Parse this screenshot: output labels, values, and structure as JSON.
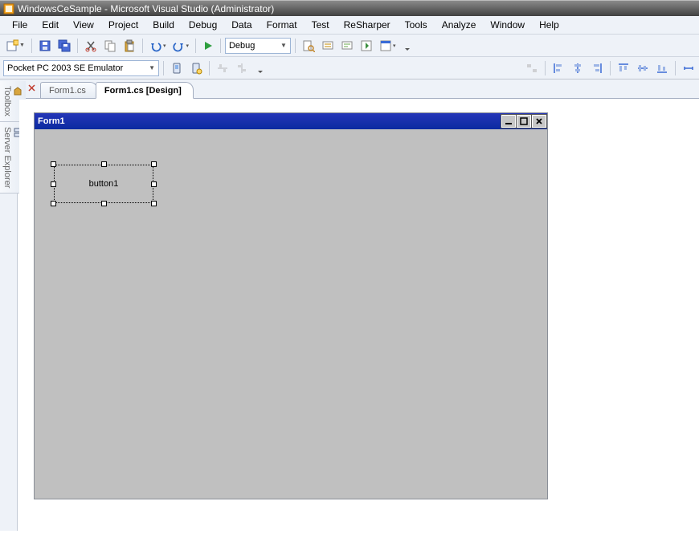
{
  "title": "WindowsCeSample - Microsoft Visual Studio (Administrator)",
  "menu": [
    "File",
    "Edit",
    "View",
    "Project",
    "Build",
    "Debug",
    "Data",
    "Format",
    "Test",
    "ReSharper",
    "Tools",
    "Analyze",
    "Window",
    "Help"
  ],
  "toolbar1": {
    "config_combo": "Debug"
  },
  "toolbar2": {
    "target_combo": "Pocket PC 2003 SE Emulator"
  },
  "side_tabs": [
    "Toolbox",
    "Server Explorer"
  ],
  "doc_tabs": [
    {
      "label": "Form1.cs",
      "active": false
    },
    {
      "label": "Form1.cs [Design]",
      "active": true
    }
  ],
  "designer": {
    "form_title": "Form1",
    "button_text": "button1"
  }
}
